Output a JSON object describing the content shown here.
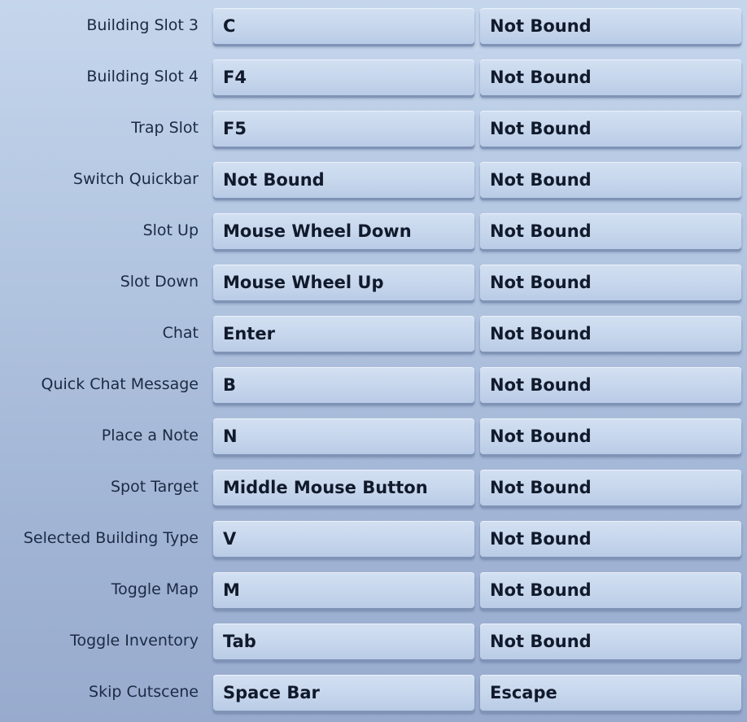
{
  "keybindings": [
    {
      "action": "Building Slot 3",
      "primary": "C",
      "secondary": "Not Bound"
    },
    {
      "action": "Building Slot 4",
      "primary": "F4",
      "secondary": "Not Bound"
    },
    {
      "action": "Trap Slot",
      "primary": "F5",
      "secondary": "Not Bound"
    },
    {
      "action": "Switch Quickbar",
      "primary": "Not Bound",
      "secondary": "Not Bound"
    },
    {
      "action": "Slot Up",
      "primary": "Mouse Wheel Down",
      "secondary": "Not Bound"
    },
    {
      "action": "Slot Down",
      "primary": "Mouse Wheel Up",
      "secondary": "Not Bound"
    },
    {
      "action": "Chat",
      "primary": "Enter",
      "secondary": "Not Bound"
    },
    {
      "action": "Quick Chat Message",
      "primary": "B",
      "secondary": "Not Bound"
    },
    {
      "action": "Place a Note",
      "primary": "N",
      "secondary": "Not Bound"
    },
    {
      "action": "Spot Target",
      "primary": "Middle Mouse Button",
      "secondary": "Not Bound"
    },
    {
      "action": "Selected Building Type",
      "primary": "V",
      "secondary": "Not Bound"
    },
    {
      "action": "Toggle Map",
      "primary": "M",
      "secondary": "Not Bound"
    },
    {
      "action": "Toggle Inventory",
      "primary": "Tab",
      "secondary": "Not Bound"
    },
    {
      "action": "Skip Cutscene",
      "primary": "Space Bar",
      "secondary": "Escape"
    }
  ]
}
